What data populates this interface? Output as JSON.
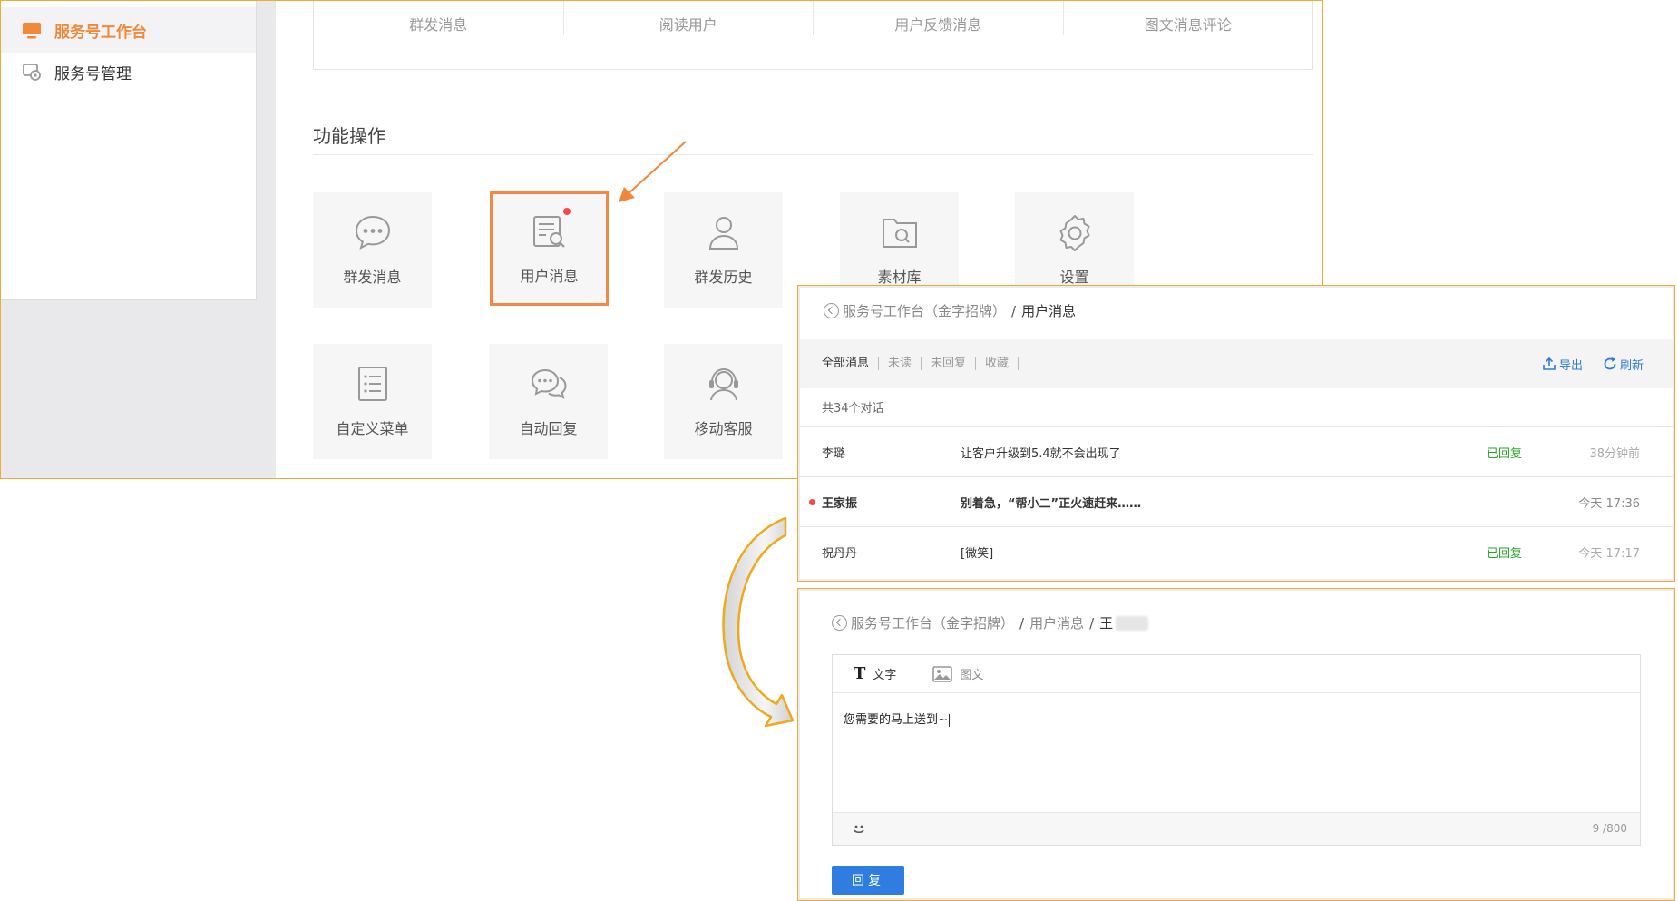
{
  "sidebar": {
    "items": [
      {
        "label": "服务号工作台",
        "icon": "monitor-icon",
        "active": true
      },
      {
        "label": "服务号管理",
        "icon": "manage-icon",
        "active": false
      }
    ]
  },
  "top_tabs": [
    "群发消息",
    "阅读用户",
    "用户反馈消息",
    "图文消息评论"
  ],
  "functions": {
    "title": "功能操作",
    "tiles": [
      {
        "label": "群发消息",
        "icon": "chat-bubble-icon"
      },
      {
        "label": "用户消息",
        "icon": "user-message-icon",
        "highlighted": true,
        "badge": true
      },
      {
        "label": "群发历史",
        "icon": "person-icon"
      },
      {
        "label": "素材库",
        "icon": "material-icon"
      },
      {
        "label": "设置",
        "icon": "gear-icon"
      },
      {
        "label": "自定义菜单",
        "icon": "list-menu-icon"
      },
      {
        "label": "自动回复",
        "icon": "double-bubble-icon"
      },
      {
        "label": "移动客服",
        "icon": "headset-icon"
      }
    ]
  },
  "messages_panel": {
    "breadcrumb": {
      "root": "服务号工作台（金字招牌）",
      "sep": "/",
      "current": "用户消息"
    },
    "filters": [
      "全部消息",
      "未读",
      "未回复",
      "收藏"
    ],
    "actions": {
      "export": "导出",
      "refresh": "刷新"
    },
    "count": "共34个对话",
    "rows": [
      {
        "name": "李璐",
        "text": "让客户升级到5.4就不会出现了",
        "status": "已回复",
        "time": "38分钟前",
        "unread": false
      },
      {
        "name": "王家振",
        "text": "别着急，“帮小二”正火速赶来……",
        "status": "",
        "time": "今天 17:36",
        "unread": true
      },
      {
        "name": "祝丹丹",
        "text": "[微笑]",
        "status": "已回复",
        "time": "今天 17:17",
        "unread": false
      }
    ]
  },
  "reply_panel": {
    "breadcrumb": {
      "root": "服务号工作台（金字招牌）",
      "sep": "/",
      "middle": "用户消息",
      "current": "王"
    },
    "tools": {
      "text": "文字",
      "image": "图文"
    },
    "content": "您需要的马上送到~",
    "counter": "9 /800",
    "reply_button": "回复"
  },
  "colors": {
    "accent_orange": "#f08a3a",
    "annotation_border": "#f2a93b",
    "link_blue": "#2e7bd6",
    "replied_green": "#2aa22a",
    "button_blue": "#2f7de0"
  }
}
